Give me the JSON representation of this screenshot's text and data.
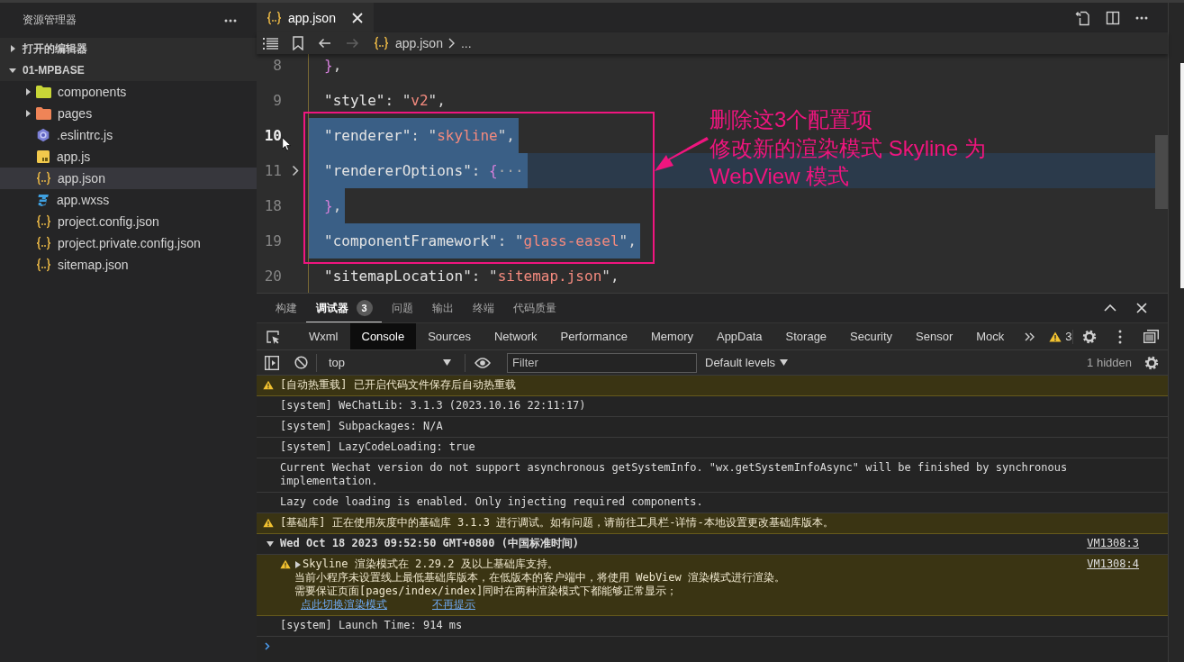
{
  "sidebar": {
    "title": "资源管理器",
    "sections": [
      {
        "label": "打开的编辑器",
        "expanded": false
      },
      {
        "label": "01-MPBASE",
        "expanded": true,
        "children": [
          {
            "label": "components",
            "kind": "folder",
            "color": "#c8d637",
            "expanded": false,
            "selected": false
          },
          {
            "label": "pages",
            "kind": "folder",
            "color": "#ef8457",
            "expanded": false,
            "selected": false
          },
          {
            "label": ".eslintrc.js",
            "kind": "eslint",
            "selected": false
          },
          {
            "label": "app.js",
            "kind": "js",
            "selected": false
          },
          {
            "label": "app.json",
            "kind": "json",
            "selected": true
          },
          {
            "label": "app.wxss",
            "kind": "css",
            "selected": false
          },
          {
            "label": "project.config.json",
            "kind": "json",
            "selected": false
          },
          {
            "label": "project.private.config.json",
            "kind": "json",
            "selected": false
          },
          {
            "label": "sitemap.json",
            "kind": "json",
            "selected": false
          }
        ]
      }
    ]
  },
  "editor": {
    "tabs": [
      {
        "label": "app.json",
        "kind": "json",
        "selected": true
      }
    ],
    "nav": [
      {
        "kind": "back",
        "disabled": false
      },
      {
        "kind": "forward",
        "disabled": true
      }
    ],
    "breadcrumb": [
      "app.json",
      "..."
    ],
    "lines": [
      {
        "number": "8",
        "current": false,
        "selected": false,
        "folded": false,
        "tokens": [
          {
            "kind": "brace",
            "text": "}"
          },
          {
            "kind": "punct",
            "text": ","
          }
        ]
      },
      {
        "number": "9",
        "current": false,
        "selected": false,
        "folded": false,
        "tokens": [
          {
            "kind": "key",
            "text": "\"style\""
          },
          {
            "kind": "punct",
            "text": ": \""
          },
          {
            "kind": "string",
            "text": "v2"
          },
          {
            "kind": "punct",
            "text": "\","
          }
        ]
      },
      {
        "number": "10",
        "current": true,
        "selected": true,
        "folded": false,
        "tokens": [
          {
            "kind": "key",
            "text": "\"renderer\""
          },
          {
            "kind": "punct",
            "text": ": \""
          },
          {
            "kind": "string",
            "text": "skyline"
          },
          {
            "kind": "punct",
            "text": "\","
          }
        ]
      },
      {
        "number": "11",
        "current": false,
        "selected": true,
        "folded": true,
        "tokens": [
          {
            "kind": "key",
            "text": "\"rendererOptions\""
          },
          {
            "kind": "punct",
            "text": ": "
          },
          {
            "kind": "brace",
            "text": "{"
          },
          {
            "kind": "fold",
            "text": "···"
          }
        ]
      },
      {
        "number": "18",
        "current": false,
        "selected": true,
        "folded": false,
        "tokens": [
          {
            "kind": "brace",
            "text": "}"
          },
          {
            "kind": "punct",
            "text": ","
          }
        ]
      },
      {
        "number": "19",
        "current": false,
        "selected": true,
        "folded": false,
        "tokens": [
          {
            "kind": "key",
            "text": "\"componentFramework\""
          },
          {
            "kind": "punct",
            "text": ": \""
          },
          {
            "kind": "string",
            "text": "glass-easel"
          },
          {
            "kind": "punct",
            "text": "\","
          }
        ]
      },
      {
        "number": "20",
        "current": false,
        "selected": false,
        "folded": false,
        "tokens": [
          {
            "kind": "key",
            "text": "\"sitemapLocation\""
          },
          {
            "kind": "punct",
            "text": ": \""
          },
          {
            "kind": "string",
            "text": "sitemap.json"
          },
          {
            "kind": "punct",
            "text": "\","
          }
        ]
      }
    ],
    "annotation": {
      "lines": [
        "删除这3个配置项",
        "修改新的渲染模式 Skyline 为",
        "WebView 模式"
      ]
    }
  },
  "panel": {
    "tabs": [
      {
        "label": "构建",
        "selected": false
      },
      {
        "label": "调试器",
        "selected": true,
        "badge": "3"
      },
      {
        "label": "问题",
        "selected": false
      },
      {
        "label": "输出",
        "selected": false
      },
      {
        "label": "终端",
        "selected": false
      },
      {
        "label": "代码质量",
        "selected": false
      }
    ],
    "devtools_tabs": [
      {
        "label": "Wxml",
        "selected": false
      },
      {
        "label": "Console",
        "selected": true
      },
      {
        "label": "Sources",
        "selected": false
      },
      {
        "label": "Network",
        "selected": false
      },
      {
        "label": "Performance",
        "selected": false
      },
      {
        "label": "Memory",
        "selected": false
      },
      {
        "label": "AppData",
        "selected": false
      },
      {
        "label": "Storage",
        "selected": false
      },
      {
        "label": "Security",
        "selected": false
      },
      {
        "label": "Sensor",
        "selected": false
      },
      {
        "label": "Mock",
        "selected": false
      }
    ],
    "warning_count": "3",
    "console": {
      "context": "top",
      "filter": {
        "placeholder": "Filter"
      },
      "levels": "Default levels",
      "hidden": "1 hidden",
      "messages": [
        {
          "kind": "warning",
          "text": "[自动热重载] 已开启代码文件保存后自动热重载"
        },
        {
          "kind": "log",
          "text": "[system] WeChatLib: 3.1.3 (2023.10.16 22:11:17)"
        },
        {
          "kind": "log",
          "text": "[system] Subpackages: N/A"
        },
        {
          "kind": "log",
          "text": "[system] LazyCodeLoading: true"
        },
        {
          "kind": "log",
          "text": "Current Wechat version do not support asynchronous getSystemInfo. \"wx.getSystemInfoAsync\" will be finished by synchronous implementation."
        },
        {
          "kind": "log",
          "text": "Lazy code loading is enabled. Only injecting required components."
        },
        {
          "kind": "warning",
          "text": "[基础库] 正在使用灰度中的基础库 3.1.3 进行调试。如有问题，请前往工具栏-详情-本地设置更改基础库版本。"
        },
        {
          "kind": "group",
          "expanded": true,
          "text": "Wed Oct 18 2023 09:52:50 GMT+0800 (中国标准时间)",
          "source": "VM1308:3",
          "children": [
            {
              "kind": "warning",
              "expanded": false,
              "lines": [
                "Skyline 渲染模式在 2.29.2 及以上基础库支持。",
                "当前小程序未设置线上最低基础库版本，在低版本的客户端中，将使用 WebView 渲染模式进行渲染。",
                "需要保证页面[pages/index/index]同时在两种渲染模式下都能够正常显示；"
              ],
              "links": [
                "点此切换渲染模式",
                "不再提示"
              ],
              "source": "VM1308:4"
            }
          ]
        },
        {
          "kind": "log",
          "text": "[system] Launch Time: 914 ms"
        }
      ]
    }
  }
}
